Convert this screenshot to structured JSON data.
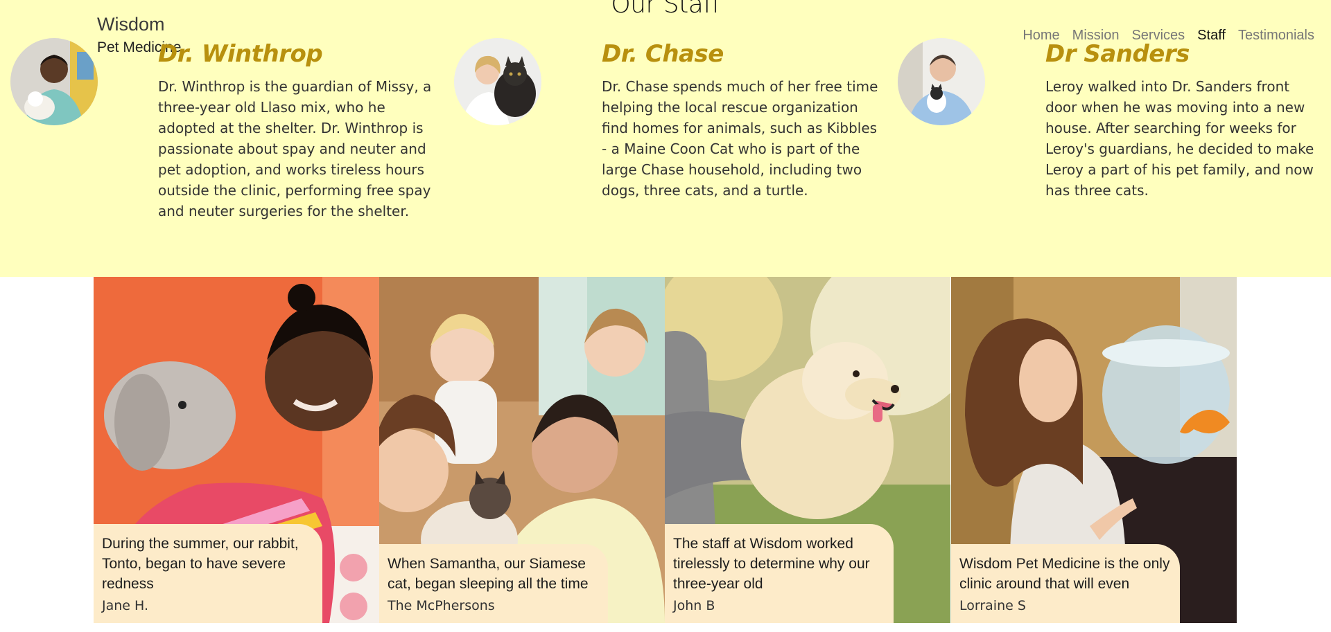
{
  "section": {
    "title": "Our Staff"
  },
  "brand": {
    "name": "Wisdom",
    "sub": "Pet Medicine"
  },
  "nav": {
    "items": [
      {
        "label": "Home"
      },
      {
        "label": "Mission"
      },
      {
        "label": "Services"
      },
      {
        "label": "Staff"
      },
      {
        "label": "Testimonials"
      }
    ],
    "active": "Staff"
  },
  "staff": [
    {
      "name": "Dr. Winthrop",
      "bio": "Dr. Winthrop is the guardian of Missy, a three-year old Llaso mix, who he adopted at the shelter. Dr. Winthrop is passionate about spay and neuter and pet adoption, and works tireless hours outside the clinic, performing free spay and neuter surgeries for the shelter."
    },
    {
      "name": "Dr. Chase",
      "bio": "Dr. Chase spends much of her free time helping the local rescue organization find homes for animals, such as Kibbles - a Maine Coon Cat who is part of the large Chase household, including two dogs, three cats, and a turtle."
    },
    {
      "name": "Dr Sanders",
      "bio": "Leroy walked into Dr. Sanders front door when he was moving into a new house. After searching for weeks for Leroy's guardians, he decided to make Leroy a part of his pet family, and now has three cats."
    }
  ],
  "testimonials": [
    {
      "quote": "During the summer, our rabbit, Tonto, began to have severe redness",
      "author": "Jane H."
    },
    {
      "quote": "When Samantha, our Siamese cat, began sleeping all the time",
      "author": "The McPhersons"
    },
    {
      "quote": "The staff at Wisdom worked tirelessly to determine why our three-year old",
      "author": "John B"
    },
    {
      "quote": "Wisdom Pet Medicine is the only clinic around that will even",
      "author": "Lorraine S"
    }
  ],
  "colors": {
    "band": "#ffffbe",
    "staff_name": "#b8900e",
    "quote_bg": "#fdebc9"
  }
}
